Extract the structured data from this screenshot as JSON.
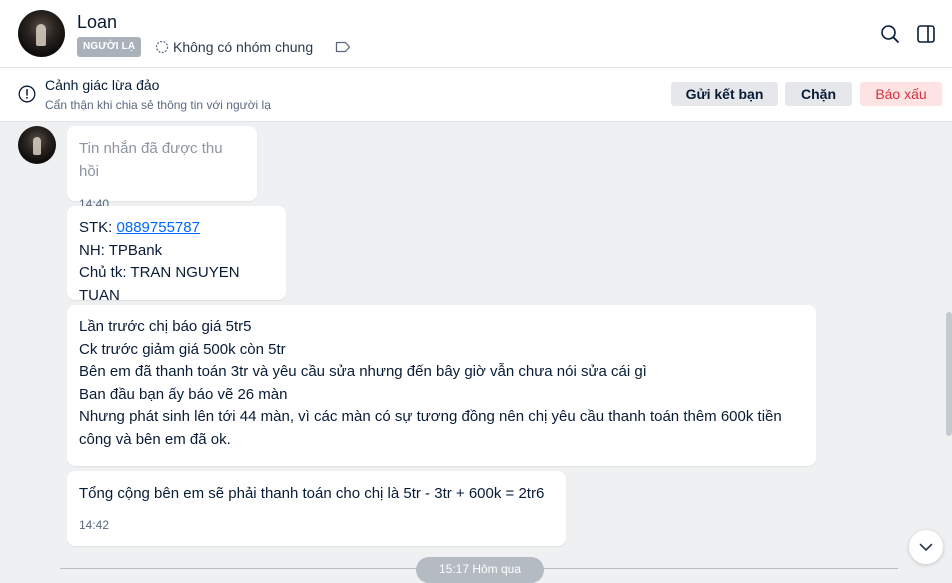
{
  "header": {
    "contact_name": "Loan",
    "stranger_badge": "NGƯỜI LẠ",
    "group_info": "Không có nhóm chung",
    "icons": [
      "search-icon",
      "side-panel-icon",
      "tag-icon",
      "group-icon"
    ]
  },
  "warning": {
    "title": "Cảnh giác lừa đảo",
    "subtitle": "Cẩn thận khi chia sẻ thông tin với người lạ",
    "add_friend": "Gửi kết bạn",
    "block": "Chặn",
    "report": "Báo xấu"
  },
  "messages": [
    {
      "text": "Tin nhắn đã được thu hồi",
      "time": "14:40",
      "recalled": true
    },
    {
      "lines": [
        {
          "label": "STK: ",
          "value": "0889755787"
        },
        "NH: TPBank",
        "Chủ tk: TRAN NGUYEN TUAN"
      ]
    },
    {
      "lines": [
        "Lần trước chị báo giá 5tr5",
        "Ck trước giảm giá 500k còn 5tr",
        "Bên em đã thanh toán 3tr và yêu cầu sửa nhưng đến bây giờ vẫn chưa nói sửa cái gì",
        "Ban đầu bạn ấy báo vẽ 26 màn",
        "Nhưng phát sinh lên tới 44 màn, vì các màn có sự tương đồng nên chị yêu cầu thanh toán thêm 600k tiền",
        "công và bên em đã ok."
      ]
    },
    {
      "text": "Tổng cộng bên em sẽ phải thanh toán cho chị là 5tr - 3tr + 600k = 2tr6",
      "time": "14:42"
    }
  ],
  "divider": {
    "label": "15:17 Hôm qua"
  }
}
